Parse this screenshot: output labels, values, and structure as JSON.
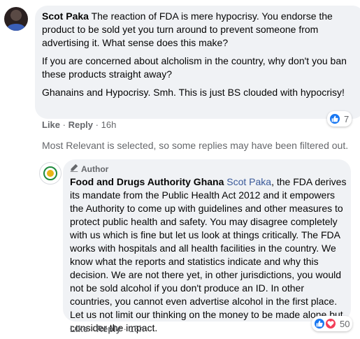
{
  "comment": {
    "author": "Scot Paka",
    "paragraphs": [
      "The reaction of FDA is mere hypocrisy. You endorse the product to be sold yet you turn around to prevent someone from advertising it. What sense does this make?",
      "If you are concerned about alcholism in the country, why don't you ban these products straight away?",
      "Ghanains and Hypocrisy. Smh. This is just BS clouded with hypocrisy!"
    ],
    "actions": {
      "like": "Like",
      "separator": "·",
      "reply": "Reply",
      "time": "16h"
    },
    "reactions": {
      "count": "7",
      "icons": [
        "like-icon"
      ]
    }
  },
  "filter_notice": "Most Relevant is selected, so some replies may have been filtered out.",
  "reply": {
    "badge": "Author",
    "author": "Food and Drugs Authority Ghana",
    "mention": "Scot Paka",
    "body": ", the FDA derives its mandate from the Public Health Act 2012 and it empowers the Authority to come up with guidelines and other measures to protect public health and safety. You may disagree completely with us which is fine but let us look at things critically. The FDA works with hospitals and all health facilities in the country. We know what the reports and statistics indicate and why this decision. We are not there yet, in other jurisdictions, you would not be sold alcohol if you don't produce an ID. In other countries, you cannot even advertise alcohol in the first place. Let us not limit our thinking on the money to be made alone but consider the impact.",
    "actions": {
      "like": "Like",
      "separator": "·",
      "reply": "Reply",
      "time": "15h"
    },
    "reactions": {
      "count": "50",
      "icons": [
        "like-icon",
        "love-icon"
      ]
    }
  },
  "colors": {
    "bubble": "#f0f2f5",
    "link": "#385898",
    "like": "#1877f2",
    "love": "#f33e58",
    "muted": "#65676b"
  }
}
